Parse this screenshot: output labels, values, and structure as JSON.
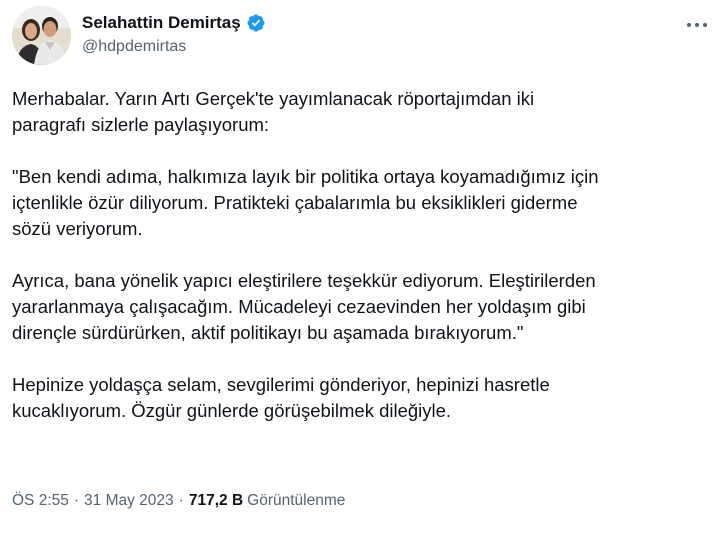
{
  "author": {
    "name": "Selahattin Demirtaş",
    "handle": "@hdpdemirtas",
    "verified_color": "#1d9bf0"
  },
  "tweet": {
    "paragraphs": [
      [
        "Merhabalar. Yarın Artı Gerçek'te yayımlanacak röportajımdan iki",
        "paragrafı sizlerle paylaşıyorum:"
      ],
      [
        "\"Ben kendi adıma, halkımıza layık bir politika ortaya koyamadığımız için",
        "içtenlikle özür diliyorum. Pratikteki çabalarımla bu eksiklikleri giderme",
        "sözü veriyorum."
      ],
      [
        "Ayrıca, bana yönelik yapıcı eleştirilere teşekkür ediyorum. Eleştirilerden",
        "yararlanmaya çalışacağım. Mücadeleyi cezaevinden her yoldaşım gibi",
        "dirençle sürdürürken, aktif politikayı bu aşamada bırakıyorum.\""
      ],
      [
        "Hepinize yoldaşça selam, sevgilerimi gönderiyor, hepinizi hasretle",
        "kucaklıyorum. Özgür günlerde görüşebilmek dileğiyle."
      ]
    ]
  },
  "meta": {
    "time": "ÖS 2:55",
    "separator": "·",
    "date": "31 May 2023",
    "views_count": "717,2 B",
    "views_label": "Görüntülenme"
  },
  "icons": {
    "verified": "verified-badge-icon",
    "more": "more-options-icon"
  }
}
